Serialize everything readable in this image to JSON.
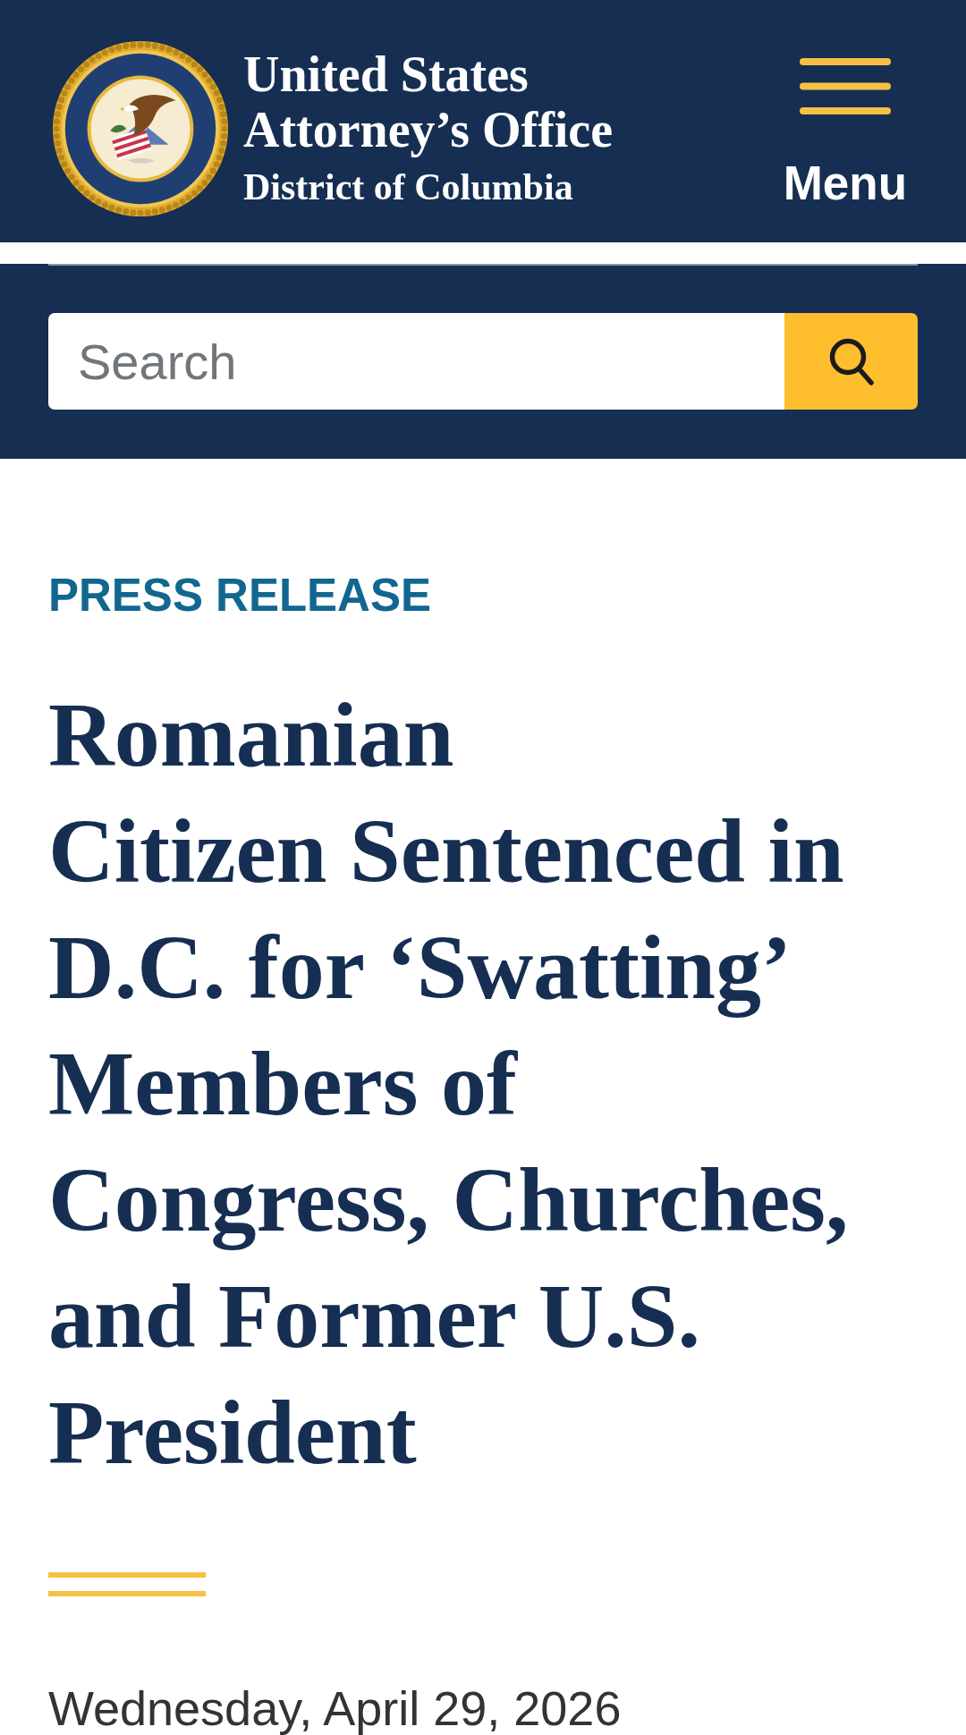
{
  "header": {
    "title": "United States\nAttorney’s Office",
    "subtitle": "District of Columbia",
    "menu_label": "Menu"
  },
  "search": {
    "placeholder": "Search"
  },
  "article": {
    "category": "PRESS RELEASE",
    "headline": "Romanian\nCitizen Sentenced in D.C. for ‘Swatting’ Members of Congress, Churches, and Former U.S. President",
    "date": "Wednesday, April 29, 2026"
  }
}
